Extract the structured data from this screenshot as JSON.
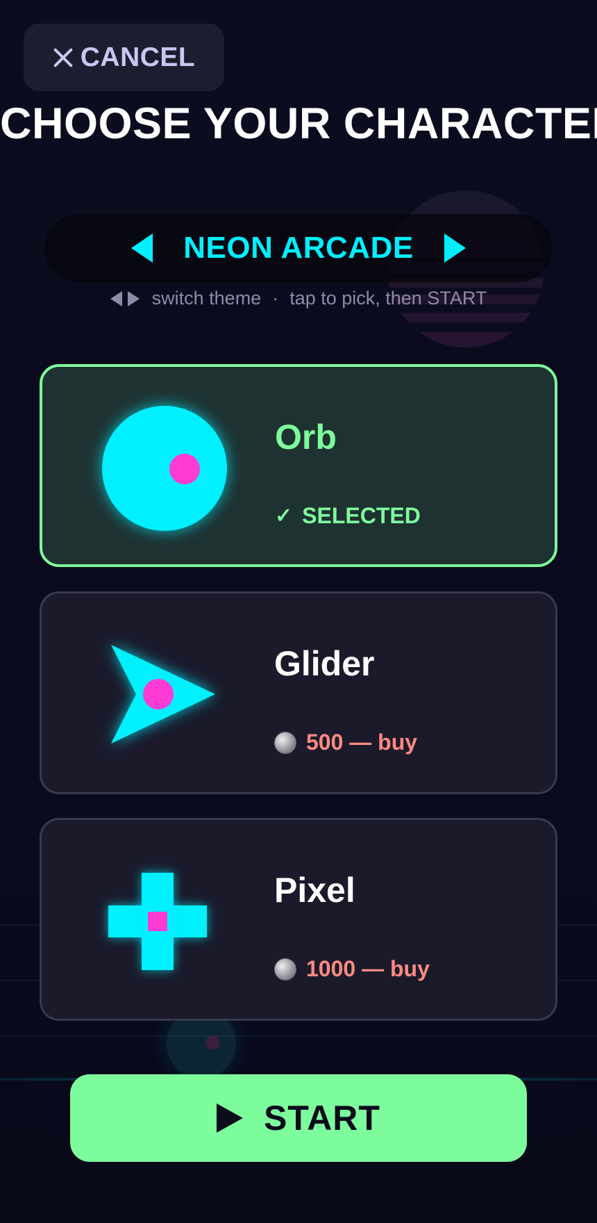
{
  "header": {
    "cancel_label": "CANCEL",
    "title": "CHOOSE YOUR CHARACTER"
  },
  "theme": {
    "name": "NEON ARCADE",
    "hint_switch": "switch theme",
    "hint_separator": "·",
    "hint_pick": "tap to pick, then START"
  },
  "characters": [
    {
      "name": "Orb",
      "status": "SELECTED",
      "selected": true
    },
    {
      "name": "Glider",
      "price_label": "500 — buy",
      "selected": false
    },
    {
      "name": "Pixel",
      "price_label": "1000 — buy",
      "selected": false
    }
  ],
  "start_label": "START",
  "colors": {
    "accent_cyan": "#00f0ff",
    "accent_green": "#7dfc9c",
    "accent_pink": "#ff3bd4",
    "price_red": "#ff8a80",
    "background": "#0a0b1c"
  },
  "icons": {
    "cancel": "close-icon",
    "theme_prev": "arrow-left-icon",
    "theme_next": "arrow-right-icon",
    "selected": "check-icon",
    "currency": "coin-icon",
    "start": "play-icon"
  }
}
